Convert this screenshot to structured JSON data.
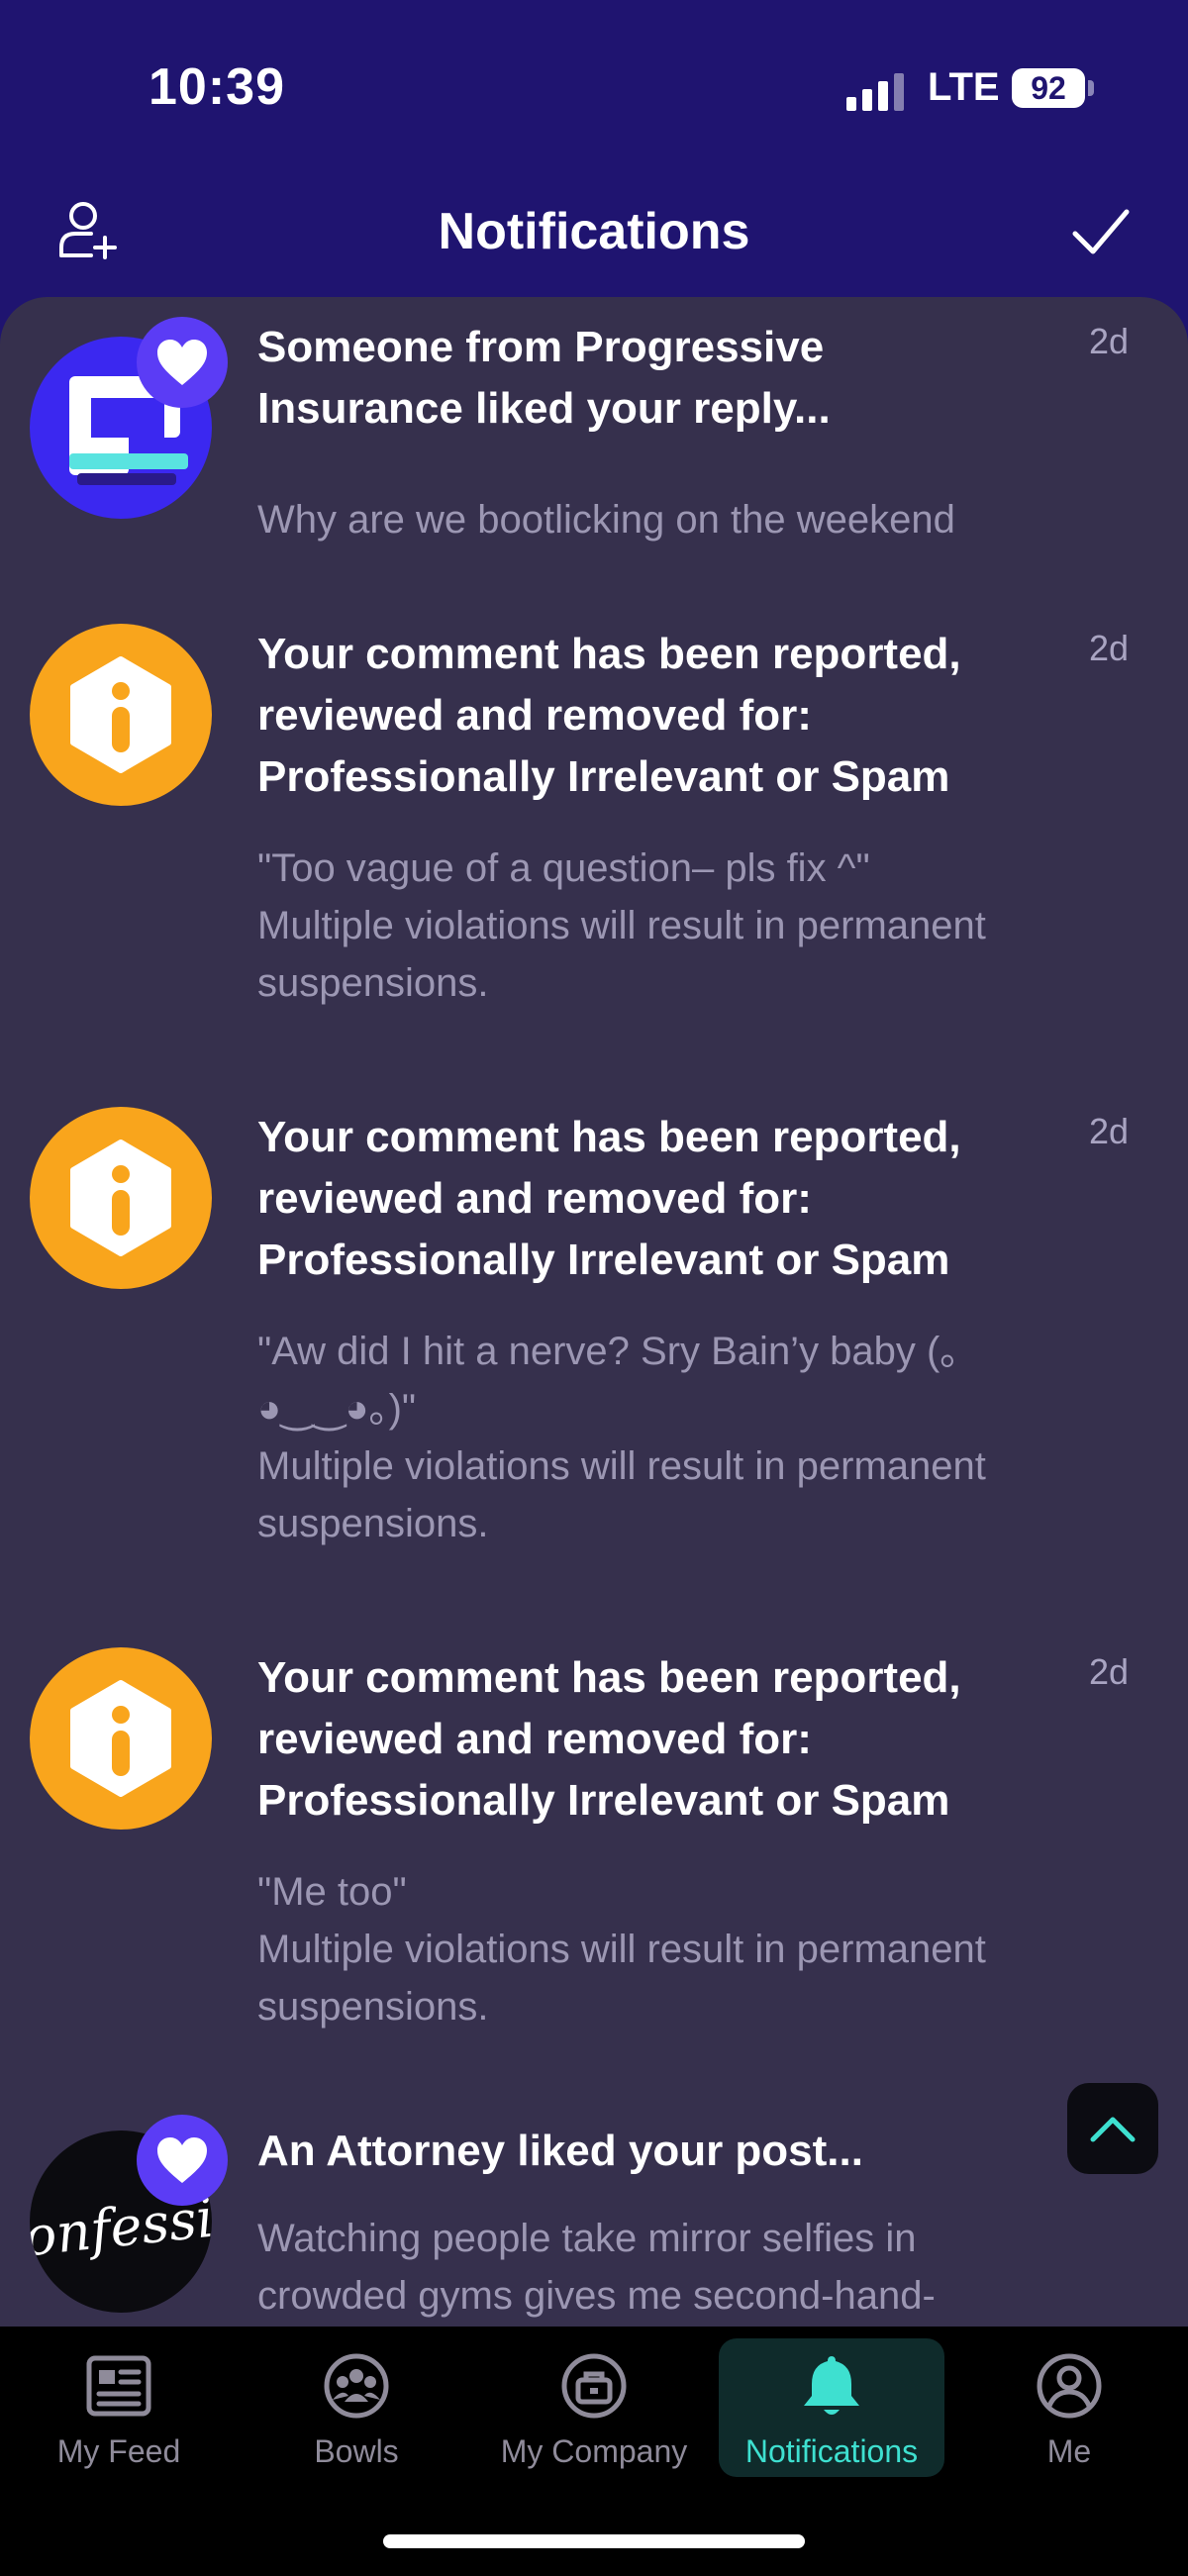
{
  "status_bar": {
    "time": "10:39",
    "network": "LTE",
    "battery": "92"
  },
  "header": {
    "title": "Notifications",
    "add_user_icon": "add-user-icon",
    "check_icon": "checkmark-icon"
  },
  "colors": {
    "background": "#1f1470",
    "panel": "#36304d",
    "accent": "#3ee0d0",
    "warning": "#f9a51c",
    "heart_badge": "#5b3cf5"
  },
  "notifications": [
    {
      "icon": "company-logo-avatar",
      "badge": "heart-icon",
      "title": "Someone from Progressive Insurance liked your reply...",
      "time": "2d",
      "body": "Why are we bootlicking on the weekend"
    },
    {
      "icon": "info-icon",
      "title": "Your comment has been reported, reviewed and removed for: Professionally Irrelevant or Spam",
      "time": "2d",
      "body": "\"Too vague of a question– pls fix ^\"\nMultiple violations will result in permanent suspensions."
    },
    {
      "icon": "info-icon",
      "title": "Your comment has been reported, reviewed and removed for: Professionally Irrelevant or Spam",
      "time": "2d",
      "body": "\"Aw did I hit a nerve? Sry Bain’y baby (｡◕‿‿◕｡)\"\nMultiple violations will result in permanent suspensions."
    },
    {
      "icon": "info-icon",
      "title": "Your comment has been reported, reviewed and removed for: Professionally Irrelevant or Spam",
      "time": "2d",
      "body": "\"Me too\"\nMultiple violations will result in permanent suspensions."
    },
    {
      "icon": "bowl-avatar",
      "avatar_text": "onfessio",
      "badge": "heart-icon",
      "title": "An Attorney liked your post...",
      "time": "2d",
      "body": "Watching people take mirror selfies in crowded gyms gives me second-hand-"
    }
  ],
  "tabs": [
    {
      "label": "My Feed",
      "icon": "feed-icon"
    },
    {
      "label": "Bowls",
      "icon": "bowls-icon"
    },
    {
      "label": "My Company",
      "icon": "company-icon"
    },
    {
      "label": "Notifications",
      "icon": "bell-icon",
      "active": true
    },
    {
      "label": "Me",
      "icon": "profile-icon"
    }
  ]
}
